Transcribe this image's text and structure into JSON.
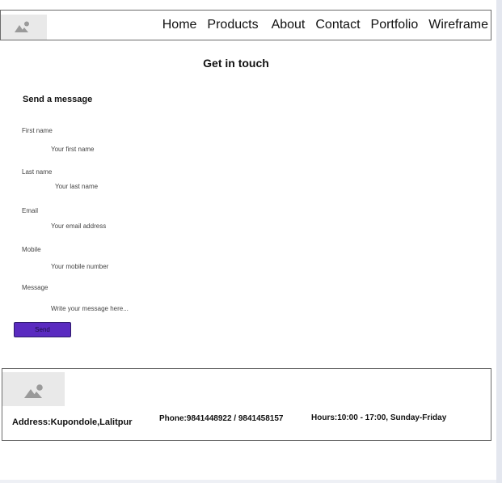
{
  "nav": {
    "items": [
      "Home",
      "Products",
      "About",
      "Contact",
      "Portfolio",
      "Wireframe"
    ]
  },
  "page": {
    "title": "Get in touch"
  },
  "form": {
    "section_title": "Send a message",
    "fields": [
      {
        "label": "First name",
        "placeholder": "Your first name"
      },
      {
        "label": "Last name",
        "placeholder": "Your last name"
      },
      {
        "label": "Email",
        "placeholder": "Your email address"
      },
      {
        "label": "Mobile",
        "placeholder": "Your mobile number"
      },
      {
        "label": "Message",
        "placeholder": "Write your message here..."
      }
    ],
    "send_label": "Send",
    "send_color": "#5a2bc0"
  },
  "footer": {
    "address": "Address:Kupondole,Lalitpur",
    "phone": "Phone:9841448922 / 9841458157",
    "hours": "Hours:10:00 - 17:00, Sunday-Friday"
  },
  "icons": {
    "header_logo": "image-placeholder-icon",
    "footer_logo": "image-placeholder-icon"
  }
}
